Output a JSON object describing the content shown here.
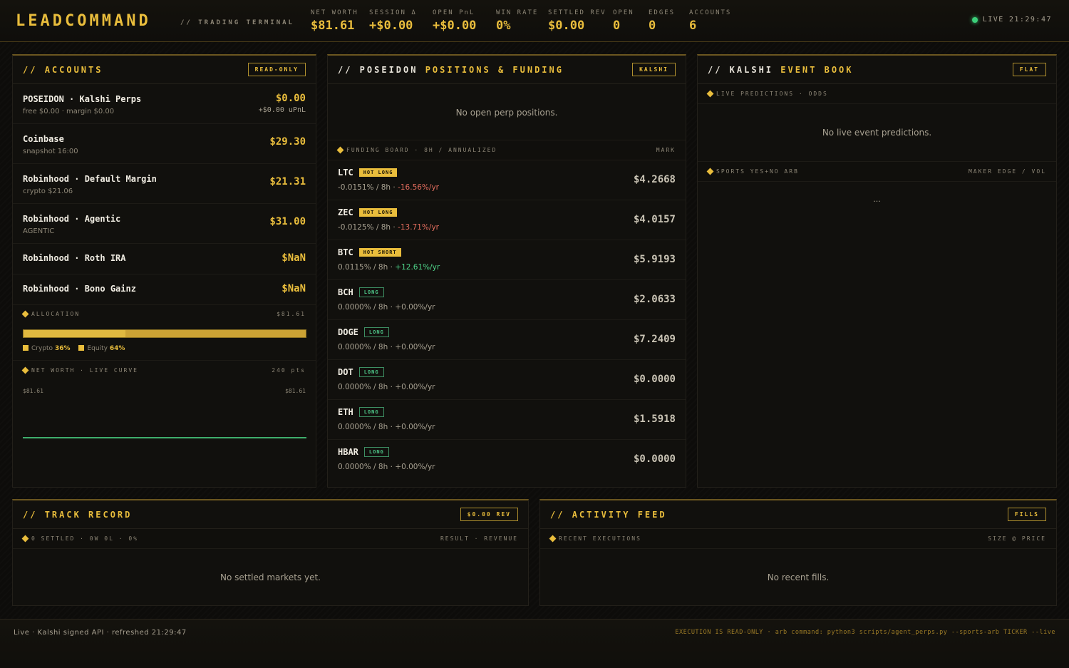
{
  "header": {
    "brand": "LEADCOMMAND",
    "brand_sub": "// TRADING TERMINAL",
    "stats": [
      {
        "label": "NET WORTH",
        "value": "$81.61"
      },
      {
        "label": "SESSION Δ",
        "value": "+$0.00"
      },
      {
        "label": "OPEN PnL",
        "value": "+$0.00"
      },
      {
        "label": "WIN RATE",
        "value": "0%"
      },
      {
        "label": "SETTLED REV",
        "value": "$0.00"
      },
      {
        "label": "OPEN",
        "value": "0"
      },
      {
        "label": "EDGES",
        "value": "0"
      },
      {
        "label": "ACCOUNTS",
        "value": "6"
      }
    ],
    "live_label": "LIVE",
    "live_time": "21:29:47"
  },
  "accounts": {
    "title_prefix": "// ",
    "title": "ACCOUNTS",
    "badge": "READ-ONLY",
    "rows": [
      {
        "name": "POSEIDON · Kalshi Perps",
        "sub": "free $0.00 · margin $0.00",
        "value": "$0.00",
        "upnl": "+$0.00 uPnL"
      },
      {
        "name": "Coinbase",
        "sub": "snapshot 16:00",
        "value": "$29.30"
      },
      {
        "name": "Robinhood · Default Margin",
        "sub": "crypto $21.06",
        "value": "$21.31"
      },
      {
        "name": "Robinhood · Agentic",
        "sub": "AGENTIC",
        "value": "$31.00"
      },
      {
        "name": "Robinhood · Roth IRA",
        "value": "$NaN"
      },
      {
        "name": "Robinhood · Bono Gainz",
        "value": "$NaN"
      }
    ],
    "allocation": {
      "label": "ALLOCATION",
      "total": "$81.61",
      "crypto_fraction": 0.36,
      "crypto_label": "Crypto",
      "crypto_pct": "36%",
      "equity_label": "Equity",
      "equity_pct": "64%"
    },
    "curve": {
      "label": "NET WORTH · LIVE CURVE",
      "points": "240 pts",
      "left_value": "$81.61",
      "right_value": "$81.61"
    }
  },
  "positions": {
    "title_prefix": "// POSEIDON ",
    "title": "POSITIONS & FUNDING",
    "badge": "KALSHI",
    "empty": "No open perp positions.",
    "funding_label": "FUNDING BOARD · 8H / ANNUALIZED",
    "funding_right": "MARK",
    "rows": [
      {
        "sym": "LTC",
        "tag": "HOT LONG",
        "tag_type": "hot",
        "rate": "-0.0151% / 8h",
        "annual": "-16.56%/yr",
        "dir": "neg",
        "mark": "$4.2668"
      },
      {
        "sym": "ZEC",
        "tag": "HOT LONG",
        "tag_type": "hot",
        "rate": "-0.0125% / 8h",
        "annual": "-13.71%/yr",
        "dir": "neg",
        "mark": "$4.0157"
      },
      {
        "sym": "BTC",
        "tag": "HOT SHORT",
        "tag_type": "hot",
        "rate": "0.0115% / 8h",
        "annual": "+12.61%/yr",
        "dir": "pos",
        "mark": "$5.9193"
      },
      {
        "sym": "BCH",
        "tag": "LONG",
        "tag_type": "long",
        "rate": "0.0000% / 8h",
        "annual": "+0.00%/yr",
        "dir": "flat",
        "mark": "$2.0633"
      },
      {
        "sym": "DOGE",
        "tag": "LONG",
        "tag_type": "long",
        "rate": "0.0000% / 8h",
        "annual": "+0.00%/yr",
        "dir": "flat",
        "mark": "$7.2409"
      },
      {
        "sym": "DOT",
        "tag": "LONG",
        "tag_type": "long",
        "rate": "0.0000% / 8h",
        "annual": "+0.00%/yr",
        "dir": "flat",
        "mark": "$0.0000"
      },
      {
        "sym": "ETH",
        "tag": "LONG",
        "tag_type": "long",
        "rate": "0.0000% / 8h",
        "annual": "+0.00%/yr",
        "dir": "flat",
        "mark": "$1.5918"
      },
      {
        "sym": "HBAR",
        "tag": "LONG",
        "tag_type": "long",
        "rate": "0.0000% / 8h",
        "annual": "+0.00%/yr",
        "dir": "flat",
        "mark": "$0.0000"
      }
    ]
  },
  "kalshi": {
    "title_prefix": "// KALSHI ",
    "title": "EVENT BOOK",
    "badge": "FLAT",
    "predictions_label": "LIVE PREDICTIONS · ODDS",
    "predictions_empty": "No live event predictions.",
    "arb_label": "SPORTS YES+NO ARB",
    "arb_right": "MAKER EDGE / VOL",
    "arb_empty": "..."
  },
  "track": {
    "title_prefix": "// ",
    "title": "TRACK RECORD",
    "badge": "$0.00 REV",
    "label": "0 SETTLED · 0W 0L · 0%",
    "right": "RESULT · REVENUE",
    "empty": "No settled markets yet."
  },
  "activity": {
    "title_prefix": "// ",
    "title": "ACTIVITY FEED",
    "badge": "FILLS",
    "label": "RECENT EXECUTIONS",
    "right": "SIZE @ PRICE",
    "empty": "No recent fills."
  },
  "footer": {
    "left": "Live · Kalshi signed API · refreshed 21:29:47",
    "right": "EXECUTION IS READ-ONLY · arb command: python3 scripts/agent_perps.py --sports-arb TICKER --live"
  },
  "colors": {
    "accent": "#e9bd3c",
    "positive": "#4fd48a",
    "negative": "#e36d5e",
    "live": "#3ccf7a",
    "curve": "#3fae6c"
  },
  "icons": [
    "live-status-dot",
    "section-diamond-icon"
  ]
}
